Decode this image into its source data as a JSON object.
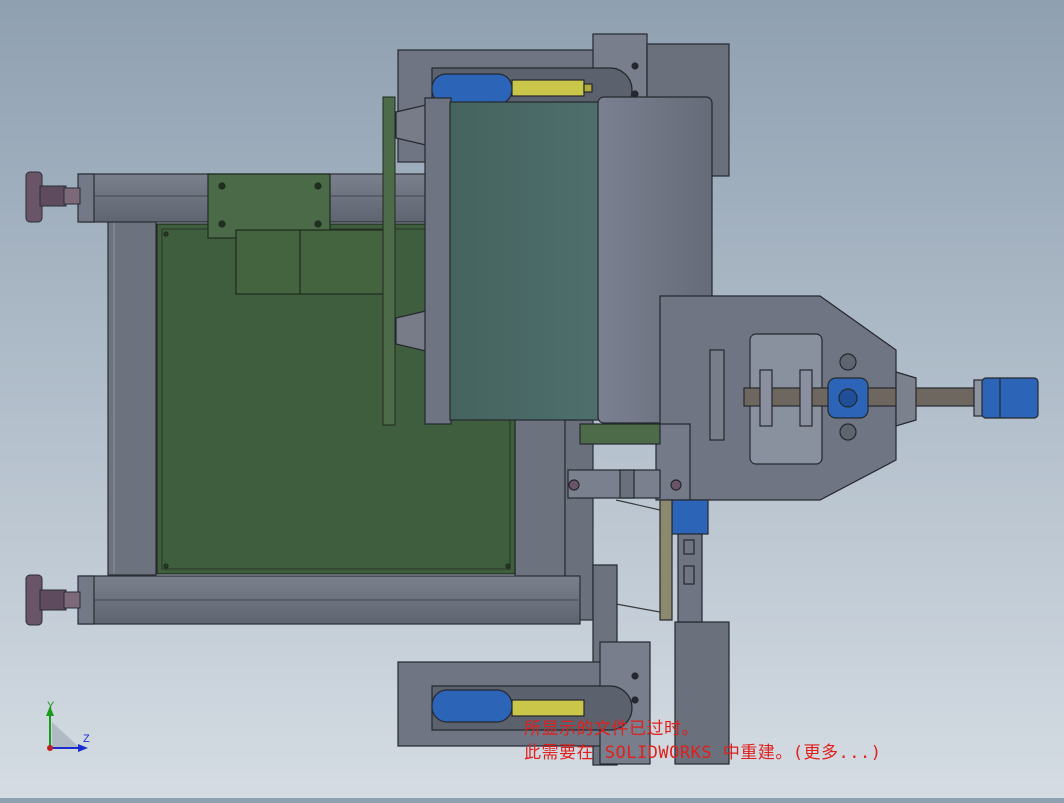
{
  "viewport": {
    "message_line1": "所显示的文件已过时。",
    "message_line2": "此需要在 SOLIDWORKS 中重建。(更多...)"
  },
  "triad": {
    "y_label": "Y",
    "z_label": "Z"
  },
  "colors": {
    "frame_steel": "#6f7582",
    "panel_green": "#3f5e3e",
    "drum_green": "#4a6a68",
    "drum_gray": "#717685",
    "cylinder_blue": "#2c64b7",
    "rod_yellow": "#c9c64a",
    "foot_purple": "#6a5468",
    "message_red": "#e0201c"
  }
}
